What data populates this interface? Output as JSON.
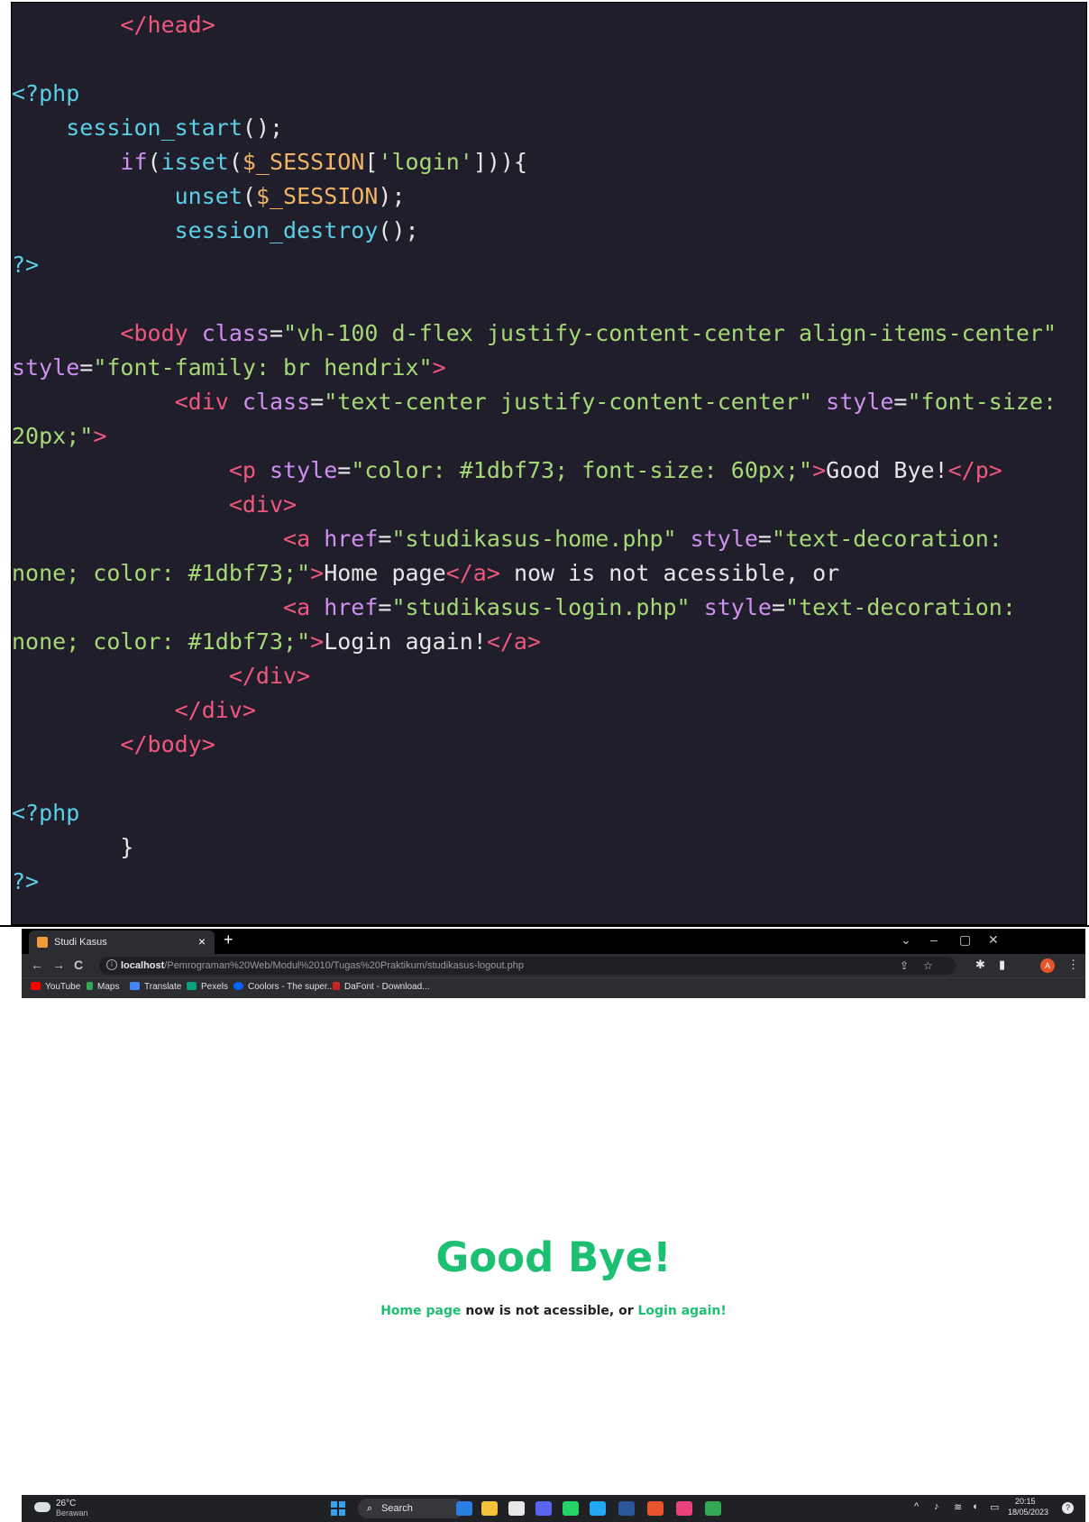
{
  "code": {
    "lines": [
      [
        {
          "t": "        ",
          "c": "plain"
        },
        {
          "t": "</head>",
          "c": "tag"
        }
      ],
      [],
      [
        {
          "t": "<?php",
          "c": "php"
        }
      ],
      [
        {
          "t": "    ",
          "c": "plain"
        },
        {
          "t": "session_start",
          "c": "fn"
        },
        {
          "t": "();",
          "c": "plain"
        }
      ],
      [
        {
          "t": "        ",
          "c": "plain"
        },
        {
          "t": "if",
          "c": "kw"
        },
        {
          "t": "(",
          "c": "plain"
        },
        {
          "t": "isset",
          "c": "fn"
        },
        {
          "t": "(",
          "c": "plain"
        },
        {
          "t": "$_SESSION",
          "c": "var"
        },
        {
          "t": "[",
          "c": "plain"
        },
        {
          "t": "'login'",
          "c": "str"
        },
        {
          "t": "])){",
          "c": "plain"
        }
      ],
      [
        {
          "t": "            ",
          "c": "plain"
        },
        {
          "t": "unset",
          "c": "fn"
        },
        {
          "t": "(",
          "c": "plain"
        },
        {
          "t": "$_SESSION",
          "c": "var"
        },
        {
          "t": ");",
          "c": "plain"
        }
      ],
      [
        {
          "t": "            ",
          "c": "plain"
        },
        {
          "t": "session_destroy",
          "c": "fn"
        },
        {
          "t": "();",
          "c": "plain"
        }
      ],
      [
        {
          "t": "?>",
          "c": "php"
        }
      ],
      [],
      [
        {
          "t": "        ",
          "c": "plain"
        },
        {
          "t": "<body",
          "c": "tag"
        },
        {
          "t": " ",
          "c": "plain"
        },
        {
          "t": "class",
          "c": "attr"
        },
        {
          "t": "=",
          "c": "plain"
        },
        {
          "t": "\"vh-100 d-flex justify-content-center align-items-center\"",
          "c": "str"
        }
      ],
      [
        {
          "t": "style",
          "c": "attr"
        },
        {
          "t": "=",
          "c": "plain"
        },
        {
          "t": "\"font-family: br hendrix\"",
          "c": "str"
        },
        {
          "t": ">",
          "c": "tag"
        }
      ],
      [
        {
          "t": "            ",
          "c": "plain"
        },
        {
          "t": "<div",
          "c": "tag"
        },
        {
          "t": " ",
          "c": "plain"
        },
        {
          "t": "class",
          "c": "attr"
        },
        {
          "t": "=",
          "c": "plain"
        },
        {
          "t": "\"text-center justify-content-center\"",
          "c": "str"
        },
        {
          "t": " ",
          "c": "plain"
        },
        {
          "t": "style",
          "c": "attr"
        },
        {
          "t": "=",
          "c": "plain"
        },
        {
          "t": "\"font-size:",
          "c": "str"
        }
      ],
      [
        {
          "t": "20px;\"",
          "c": "str"
        },
        {
          "t": ">",
          "c": "tag"
        }
      ],
      [
        {
          "t": "                ",
          "c": "plain"
        },
        {
          "t": "<p",
          "c": "tag"
        },
        {
          "t": " ",
          "c": "plain"
        },
        {
          "t": "style",
          "c": "attr"
        },
        {
          "t": "=",
          "c": "plain"
        },
        {
          "t": "\"color: #1dbf73; font-size: 60px;\"",
          "c": "str"
        },
        {
          "t": ">",
          "c": "tag"
        },
        {
          "t": "Good Bye!",
          "c": "plain"
        },
        {
          "t": "</p>",
          "c": "tag"
        }
      ],
      [
        {
          "t": "                ",
          "c": "plain"
        },
        {
          "t": "<div>",
          "c": "tag"
        }
      ],
      [
        {
          "t": "                    ",
          "c": "plain"
        },
        {
          "t": "<a",
          "c": "tag"
        },
        {
          "t": " ",
          "c": "plain"
        },
        {
          "t": "href",
          "c": "attr"
        },
        {
          "t": "=",
          "c": "plain"
        },
        {
          "t": "\"studikasus-home.php\"",
          "c": "str"
        },
        {
          "t": " ",
          "c": "plain"
        },
        {
          "t": "style",
          "c": "attr"
        },
        {
          "t": "=",
          "c": "plain"
        },
        {
          "t": "\"text-decoration:",
          "c": "str"
        }
      ],
      [
        {
          "t": "none; color: #1dbf73;\"",
          "c": "str"
        },
        {
          "t": ">",
          "c": "tag"
        },
        {
          "t": "Home page",
          "c": "plain"
        },
        {
          "t": "</a>",
          "c": "tag"
        },
        {
          "t": " now is not acessible, or",
          "c": "plain"
        }
      ],
      [
        {
          "t": "                    ",
          "c": "plain"
        },
        {
          "t": "<a",
          "c": "tag"
        },
        {
          "t": " ",
          "c": "plain"
        },
        {
          "t": "href",
          "c": "attr"
        },
        {
          "t": "=",
          "c": "plain"
        },
        {
          "t": "\"studikasus-login.php\"",
          "c": "str"
        },
        {
          "t": " ",
          "c": "plain"
        },
        {
          "t": "style",
          "c": "attr"
        },
        {
          "t": "=",
          "c": "plain"
        },
        {
          "t": "\"text-decoration:",
          "c": "str"
        }
      ],
      [
        {
          "t": "none; color: #1dbf73;\"",
          "c": "str"
        },
        {
          "t": ">",
          "c": "tag"
        },
        {
          "t": "Login again!",
          "c": "plain"
        },
        {
          "t": "</a>",
          "c": "tag"
        }
      ],
      [
        {
          "t": "                ",
          "c": "plain"
        },
        {
          "t": "</div>",
          "c": "tag"
        }
      ],
      [
        {
          "t": "            ",
          "c": "plain"
        },
        {
          "t": "</div>",
          "c": "tag"
        }
      ],
      [
        {
          "t": "        ",
          "c": "plain"
        },
        {
          "t": "</body>",
          "c": "tag"
        }
      ],
      [],
      [
        {
          "t": "<?php",
          "c": "php"
        }
      ],
      [
        {
          "t": "        }",
          "c": "plain"
        }
      ],
      [
        {
          "t": "?>",
          "c": "php"
        }
      ]
    ]
  },
  "browser": {
    "tab_title": "Studi Kasus",
    "tab_close": "×",
    "new_tab": "+",
    "window_controls": [
      "⌄",
      "–",
      "▢",
      "✕"
    ],
    "nav": {
      "back": "←",
      "forward": "→",
      "reload": "C"
    },
    "url_host": "localhost",
    "url_path": "/Pemrograman%20Web/Modul%2010/Tugas%20Praktikum/studikasus-logout.php",
    "profile_initial": "A",
    "bookmarks": [
      {
        "label": "YouTube",
        "color": "#ff0000"
      },
      {
        "label": "Maps",
        "color": "#34a853"
      },
      {
        "label": "Translate",
        "color": "#4285f4"
      },
      {
        "label": "Pexels",
        "color": "#05a081"
      },
      {
        "label": "Coolors - The super...",
        "color": "#0066ff"
      },
      {
        "label": "DaFont - Download...",
        "color": "#cc2222"
      }
    ],
    "page": {
      "heading": "Good Bye!",
      "link_home": "Home page",
      "middle_text": " now is not acessible, or ",
      "link_login": "Login again!",
      "accent_color": "#1dbf73"
    }
  },
  "taskbar": {
    "temperature": "26°C",
    "weather": "Berawan",
    "search_label": "Search",
    "time": "20:15",
    "date": "18/05/2023",
    "apps": [
      {
        "name": "bing-icon",
        "color": "#2a7de1"
      },
      {
        "name": "file-explorer-icon",
        "color": "#f5c33b"
      },
      {
        "name": "teams-icon",
        "color": "#e8e8e8"
      },
      {
        "name": "discord-icon",
        "color": "#5865f2"
      },
      {
        "name": "whatsapp-icon",
        "color": "#25d366"
      },
      {
        "name": "vscode-icon",
        "color": "#23a9f2"
      },
      {
        "name": "word-icon",
        "color": "#2b579a"
      },
      {
        "name": "chrome-icon",
        "color": "#e8552a"
      },
      {
        "name": "intellij-icon",
        "color": "#e8427c"
      },
      {
        "name": "chrome-profile-icon",
        "color": "#34a853"
      }
    ]
  }
}
